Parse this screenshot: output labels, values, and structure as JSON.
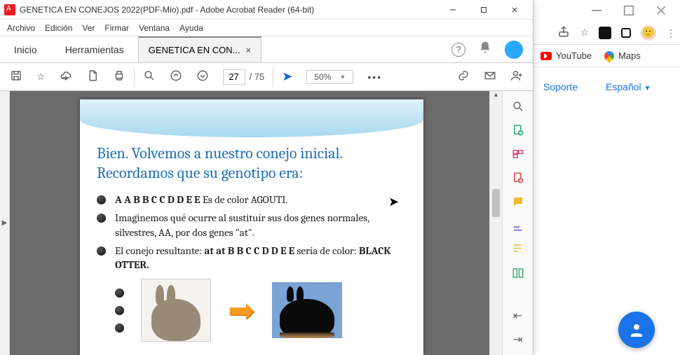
{
  "acrobat": {
    "window_title": "GENETICA EN CONEJOS 2022(PDF-Mio).pdf - Adobe Acrobat Reader (64-bit)",
    "menu": [
      "Archivo",
      "Edición",
      "Ver",
      "Firmar",
      "Ventana",
      "Ayuda"
    ],
    "tabs": {
      "home": "Inicio",
      "tools": "Herramientas",
      "doc": "GENETICA EN CON..."
    },
    "page_current": "27",
    "page_total": "/ 75",
    "zoom": "50%"
  },
  "slide": {
    "heading": "Bien. Volvemos a nuestro conejo inicial. Recordamos que su genotipo era:",
    "b1a": "A A   B B   C C   D D   E E",
    "b1b": "  Es de color AGOUTI.",
    "b2": "Imaginemos qué ocurre al sustituír sus dos genes normales, silvestres, AA, por dos genes \"at\".",
    "b3a": "El conejo resultante: ",
    "b3b": "at at B B C C D D E E",
    "b3c": " sería de color: ",
    "b3d": "BLACK OTTER."
  },
  "chrome": {
    "bookmarks": {
      "youtube": "YouTube",
      "maps": "Maps"
    },
    "page": {
      "support": "Soporte",
      "lang": "Español"
    }
  }
}
